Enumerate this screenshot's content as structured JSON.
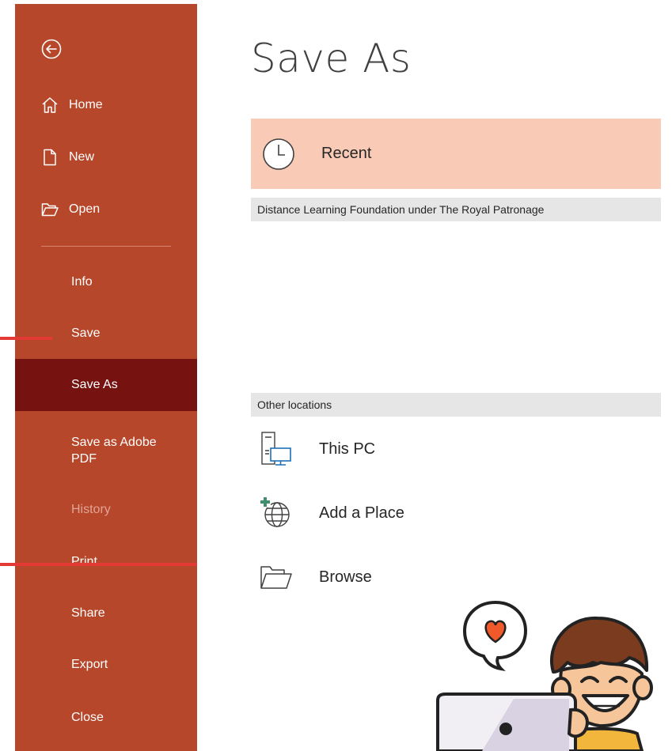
{
  "sidebar": {
    "back_icon": "back-arrow-icon",
    "primary": [
      {
        "label": "Home",
        "icon": "home-icon"
      },
      {
        "label": "New",
        "icon": "new-document-icon"
      },
      {
        "label": "Open",
        "icon": "open-folder-icon"
      }
    ],
    "items": [
      {
        "label": "Info"
      },
      {
        "label": "Save"
      },
      {
        "label": "Save As",
        "active": true
      },
      {
        "label": "Save as Adobe PDF"
      },
      {
        "label": "History",
        "disabled": true
      },
      {
        "label": "Print"
      },
      {
        "label": "Share"
      },
      {
        "label": "Export"
      },
      {
        "label": "Close"
      }
    ],
    "colors": {
      "background": "#b7472a",
      "active": "#761310"
    }
  },
  "main": {
    "title": "Save As",
    "recent": {
      "label": "Recent",
      "icon": "clock-icon",
      "color": "#f9cbb7"
    },
    "org_header": "Distance Learning Foundation under The Royal Patronage",
    "other_header": "Other locations",
    "locations": [
      {
        "label": "This PC",
        "icon": "computer-icon"
      },
      {
        "label": "Add a Place",
        "icon": "add-place-globe-icon"
      },
      {
        "label": "Browse",
        "icon": "browse-folder-icon"
      }
    ]
  },
  "annotations": {
    "callout_color": "#e53935"
  },
  "sticker": {
    "icon": "boy-with-laptop-sticker",
    "bubble_icon": "heart-speech-bubble-icon"
  }
}
